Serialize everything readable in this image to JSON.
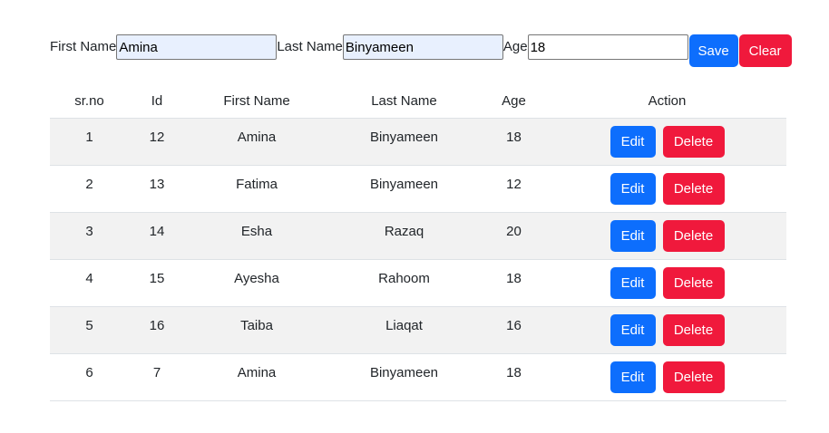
{
  "form": {
    "first_name_label": "First Name",
    "first_name_value": "Amina",
    "last_name_label": "Last Name",
    "last_name_value": "Binyameen",
    "age_label": "Age",
    "age_value": "18",
    "save_label": "Save",
    "clear_label": "Clear"
  },
  "table": {
    "headers": {
      "srno": "sr.no",
      "id": "Id",
      "first_name": "First Name",
      "last_name": "Last Name",
      "age": "Age",
      "action": "Action"
    },
    "rows": [
      {
        "srno": "1",
        "id": "12",
        "first_name": "Amina",
        "last_name": "Binyameen",
        "age": "18"
      },
      {
        "srno": "2",
        "id": "13",
        "first_name": "Fatima",
        "last_name": "Binyameen",
        "age": "12"
      },
      {
        "srno": "3",
        "id": "14",
        "first_name": "Esha",
        "last_name": "Razaq",
        "age": "20"
      },
      {
        "srno": "4",
        "id": "15",
        "first_name": "Ayesha",
        "last_name": "Rahoom",
        "age": "18"
      },
      {
        "srno": "5",
        "id": "16",
        "first_name": "Taiba",
        "last_name": "Liaqat",
        "age": "16"
      },
      {
        "srno": "6",
        "id": "7",
        "first_name": "Amina",
        "last_name": "Binyameen",
        "age": "18"
      }
    ],
    "edit_label": "Edit",
    "delete_label": "Delete"
  },
  "colors": {
    "primary": "#0d6efd",
    "danger": "#f0193c",
    "stripe": "#f2f2f2",
    "autofill": "#e8f0fe"
  }
}
